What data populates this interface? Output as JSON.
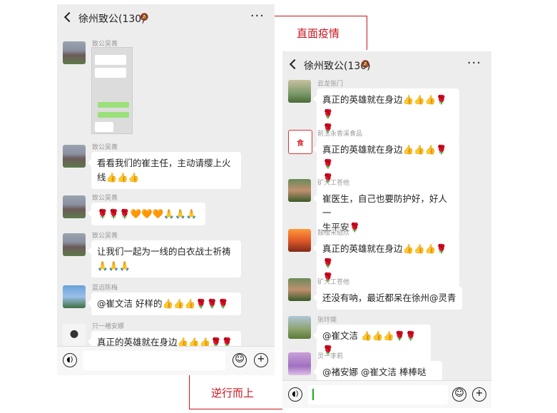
{
  "left": {
    "title": "徐州致公(130)",
    "mute_icon": "mute-icon",
    "messages": [
      {
        "sender": "致公吴菁",
        "type": "image"
      },
      {
        "sender": "致公吴菁",
        "lines": [
          "看看我们的崔主任，主动请缨上火",
          "线👍👍👍"
        ]
      },
      {
        "sender": "致公吴菁",
        "lines": [
          "🌹🌹🌹🧡🧡🧡🙏🙏🙏"
        ]
      },
      {
        "sender": "致公吴菁",
        "lines": [
          "让我们一起为一线的白衣战士祈祷",
          "🙏🙏🙏"
        ]
      },
      {
        "sender": "蓝迈陈梅",
        "lines": [
          "@崔文洁  好样的👍👍👍🌹🌹🌹"
        ]
      },
      {
        "sender": "只一褚安娜",
        "lines": [
          "真正的英雄就在身边👍👍👍🌹🌹"
        ]
      }
    ]
  },
  "right": {
    "title": "徐州致公(130)",
    "messages": [
      {
        "sender": "云龙张门",
        "lines": [
          "真正的英雄就在身边👍👍👍🌹🌹",
          "🌹"
        ]
      },
      {
        "sender": "前玉永香溪食品",
        "lines": [
          "真正的英雄就在身边👍👍👍🌹🌹",
          "🌹"
        ]
      },
      {
        "sender": "矿大工苍他",
        "lines": [
          "崔医生，自己也要防护好，好人一",
          "生平安🌹"
        ]
      },
      {
        "sender": "鼓楼宋绍欣",
        "lines": [
          "真正的英雄就在身边👍👍👍🌹🌹",
          "🌹"
        ]
      },
      {
        "sender": "矿大工苍他",
        "lines": [
          "还没有呐，最近都呆在徐州@灵青"
        ]
      },
      {
        "sender": "张玲瑜",
        "lines": [
          "@崔文洁 👍👍👍🌹🌹🌹"
        ]
      },
      {
        "sender": "灵一李莉",
        "lines": [
          "@褚安娜 @崔文洁  棒棒哒👍"
        ]
      }
    ]
  },
  "callouts": {
    "top": "直面疫情",
    "bottom": "逆行而上"
  },
  "colors": {
    "accent": "#c8161d",
    "chat_bg": "#ededed",
    "bubble": "#ffffff"
  }
}
